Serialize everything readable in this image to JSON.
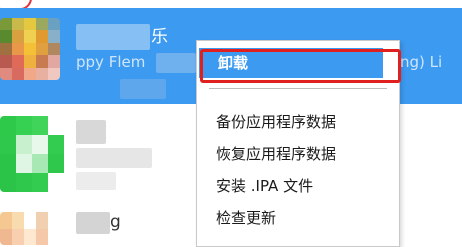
{
  "app_list": {
    "rows": [
      {
        "name_suffix": "乐",
        "subtitle_left": "ppy Flem",
        "subtitle_right": "ng) Li"
      },
      {
        "name_suffix": ""
      },
      {
        "name_suffix": "g"
      }
    ]
  },
  "context_menu": {
    "items": [
      {
        "label": "卸载"
      },
      {
        "label": "备份应用程序数据"
      },
      {
        "label": "恢复应用程序数据"
      },
      {
        "label": "安装 .IPA 文件"
      },
      {
        "label": "检查更新"
      }
    ]
  },
  "colors": {
    "selection": "#3c9af0",
    "annotation": "#e0201e"
  }
}
